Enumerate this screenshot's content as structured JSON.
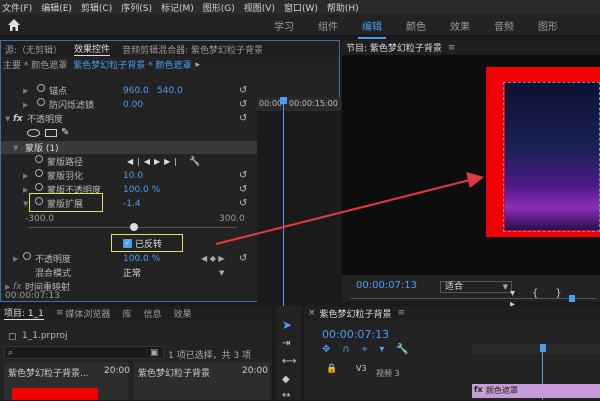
{
  "menu": [
    "文件(F)",
    "编辑(E)",
    "剪辑(C)",
    "序列(S)",
    "标记(M)",
    "图形(G)",
    "视图(V)",
    "窗口(W)",
    "帮助(H)"
  ],
  "workspaces": {
    "tabs": [
      "学习",
      "组件",
      "编辑",
      "颜色",
      "效果",
      "音频",
      "图形"
    ],
    "active": "编辑"
  },
  "effect_controls": {
    "tab_source": "源:（无剪辑）",
    "tab_effects": "效果控件",
    "tab_audio_mixer": "音频剪辑混合器: 紫色梦幻粒子背景",
    "clip_path": "主要 * 颜色遮罩",
    "clip_path_link": "紫色梦幻粒子背景 * 颜色遮罩",
    "timecode_start": "00:00",
    "timecode_mid": "00:00:15:00",
    "anchor_label": "锚点",
    "anchor_x": "960.0",
    "anchor_y": "540.0",
    "antiflicker_label": "防闪烁滤镜",
    "antiflicker_value": "0.00",
    "opacity_header": "不透明度",
    "mask_label": "蒙版 (1)",
    "mask_path_label": "蒙版路径",
    "mask_feather_label": "蒙版羽化",
    "mask_feather_value": "10.0",
    "mask_opacity_label": "蒙版不透明度",
    "mask_opacity_value": "100.0 %",
    "mask_expansion_label": "蒙版扩展",
    "mask_expansion_value": "-1.4",
    "slider_min": "-300.0",
    "slider_max": "300.0",
    "inverted_label": "已反转",
    "opacity_label": "不透明度",
    "opacity_value": "100.0 %",
    "blend_label": "混合模式",
    "blend_value": "正常",
    "time_remap_label": "时间重映射",
    "footer_timecode": "00:00:07:13"
  },
  "program": {
    "title": "节目: 紫色梦幻粒子背景",
    "timecode": "00:00:07:13",
    "fit": "适合"
  },
  "project": {
    "tab_project": "项目: 1_1",
    "tab_media": "媒体浏览器",
    "tab_lib": "库",
    "tab_info": "信息",
    "tab_effects": "效果",
    "file": "1_1.prproj",
    "selection": "1 项已选择，共 3 项",
    "item_name": "紫色梦幻粒子背景...",
    "item_dur1": "20:00",
    "item_name2": "紫色梦幻粒子背景",
    "item_dur2": "20:00"
  },
  "timeline": {
    "title": "紫色梦幻粒子背景",
    "timecode": "00:00:07:13",
    "track_v3": "V3",
    "track_v3_name": "视频 3",
    "clip_label": "颜色遮罩"
  },
  "colors": {
    "accent": "#4a9cf5",
    "red": "#f00000",
    "highlight": "#e8e34a"
  }
}
